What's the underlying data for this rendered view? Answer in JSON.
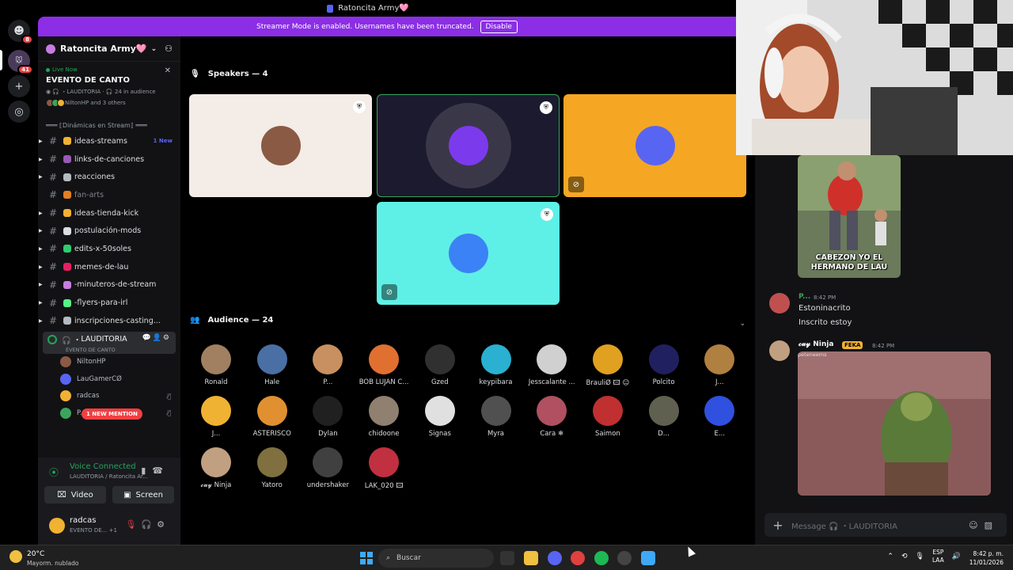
{
  "titlebar": {
    "title": "Ratoncita Army🩷"
  },
  "rail": {
    "home_badge": "8",
    "server_badge": "41"
  },
  "banner": {
    "text": "Streamer Mode is enabled. Usernames have been truncated.",
    "button": "Disable"
  },
  "server": {
    "name": "Ratoncita Army🩷"
  },
  "live": {
    "label": "Live Now",
    "event": "EVENTO DE CANTO",
    "meta_channel": "LAUDITORIA",
    "meta_audience": "24 in audience",
    "attendees": "NiltonHP and 3 others"
  },
  "category": "═══ ⟦Dinámicas en Stream⟧ ═══",
  "channels": [
    {
      "name": "ideas-streams",
      "badge": "1 New",
      "muted": false,
      "color": "#f0b232"
    },
    {
      "name": "links-de-canciones",
      "badge": "",
      "muted": false,
      "color": "#9b59b6"
    },
    {
      "name": "reacciones",
      "badge": "",
      "muted": false,
      "color": "#b5bac1"
    },
    {
      "name": "fan-arts",
      "badge": "",
      "muted": true,
      "color": "#e67e22"
    },
    {
      "name": "ideas-tienda-kick",
      "badge": "",
      "muted": false,
      "color": "#f0b232"
    },
    {
      "name": "postulación-mods",
      "badge": "",
      "muted": false,
      "color": "#dbdee1"
    },
    {
      "name": "edits-x-50soles",
      "badge": "",
      "muted": false,
      "color": "#2ecc71"
    },
    {
      "name": "memes-de-lau",
      "badge": "",
      "muted": false,
      "color": "#e91e63"
    },
    {
      "name": "-minuteros-de-stream",
      "badge": "",
      "muted": false,
      "color": "#c77de0"
    },
    {
      "name": "-flyers-para-irl",
      "badge": "",
      "muted": false,
      "color": "#57f287"
    },
    {
      "name": "inscripciones-casting...",
      "badge": "",
      "muted": false,
      "color": "#b5bac1"
    }
  ],
  "voice_channel": {
    "name": "LAUDITORIA",
    "sub": "EVENTO DE CANTO"
  },
  "voice_users": [
    {
      "name": "NiltonHP",
      "color": "#8a5a44",
      "muted": false,
      "tag": ""
    },
    {
      "name": "LauGamerCØ",
      "color": "#5865f2",
      "muted": false,
      "tag": ""
    },
    {
      "name": "radcas",
      "color": "#f0b232",
      "muted": true,
      "tag": ""
    },
    {
      "name": "P...",
      "color": "#3ba55c",
      "muted": true,
      "tag": "🍃RE"
    }
  ],
  "mention_pill": "1 NEW MENTION",
  "voice_panel": {
    "status": "Voice Connected",
    "location": "LAUDITORIA / Ratoncita Ar...",
    "video": "Video",
    "screen": "Screen"
  },
  "user": {
    "name": "radcas",
    "status": "EVENTO DE...",
    "extra": "+1"
  },
  "stage": {
    "speakers_title": "Speakers — 4",
    "audience_title": "Audience — 24"
  },
  "speakers": [
    {
      "bg": "#f3ece7",
      "av": "#8a5a44",
      "mod": true,
      "muted": false
    },
    {
      "bg": "#1c1a2e",
      "av": "#7c3aed",
      "mod": true,
      "muted": false
    },
    {
      "bg": "#f5a623",
      "av": "#5865f2",
      "mod": false,
      "muted": true
    },
    {
      "bg": "#5ef0e6",
      "av": "#3b82f6",
      "mod": true,
      "muted": true
    }
  ],
  "audience": [
    {
      "name": "Ronald",
      "color": "#a08060"
    },
    {
      "name": "Hale",
      "color": "#4a6fa5"
    },
    {
      "name": "P...",
      "color": "#c89060"
    },
    {
      "name": "BOB LUJAN C...",
      "color": "#e07030"
    },
    {
      "name": "Gzed",
      "color": "#303030"
    },
    {
      "name": "keypibara",
      "color": "#2ab0d0"
    },
    {
      "name": "Jesscalante ...",
      "color": "#d0d0d0"
    },
    {
      "name": "BrauliØ 🖾 ☺",
      "color": "#e0a020"
    },
    {
      "name": "Polcito",
      "color": "#202060"
    },
    {
      "name": "J...",
      "color": "#b08040"
    },
    {
      "name": "J...",
      "color": "#f0b232"
    },
    {
      "name": "ASTERISCO",
      "color": "#e09030"
    },
    {
      "name": "Dylan",
      "color": "#202020"
    },
    {
      "name": "chidoone",
      "color": "#908070"
    },
    {
      "name": "Signas",
      "color": "#e0e0e0"
    },
    {
      "name": "Myra",
      "color": "#505050"
    },
    {
      "name": "Cara ❄",
      "color": "#b05060"
    },
    {
      "name": "Saimon",
      "color": "#c03030"
    },
    {
      "name": "D...",
      "color": "#606050"
    },
    {
      "name": "E...",
      "color": "#3050e0"
    },
    {
      "name": "𝓬𝓾𝔂 Ninja",
      "color": "#c0a080"
    },
    {
      "name": "Yatoro",
      "color": "#807040"
    },
    {
      "name": "undershaker",
      "color": "#404040"
    },
    {
      "name": "LAK_020 🖾",
      "color": "#c03040"
    }
  ],
  "chat": {
    "meme_caption": "CABEZON YO EL HERMANO DE LAU",
    "msg1_name": "P...",
    "msg1_time": "8:42 PM",
    "msg1_line1": "Estoninacrito",
    "msg1_line2": "Inscrito estoy",
    "msg2_name": "𝓬𝓾𝔂 Ninja",
    "msg2_tag": "FEKA",
    "msg2_time": "8:42 PM",
    "msg2_gif_label": "peteneems",
    "input_placeholder": "Message 🎧 ・LAUDITORIA"
  },
  "taskbar": {
    "temp": "20°C",
    "weather": "Mayorm. nublado",
    "search": "Buscar",
    "lang1": "ESP",
    "lang2": "LAA",
    "time": "8:42 p. m.",
    "date": "11/01/2026"
  }
}
